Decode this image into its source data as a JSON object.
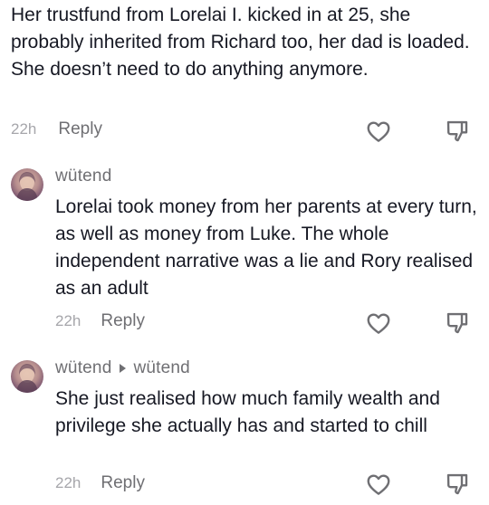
{
  "comments": [
    {
      "username": "",
      "text": "Her trustfund from Lorelai I. kicked in at 25, she probably inherited from Richard too, her dad is loaded. She doesn’t need to do anything anymore.",
      "time": "22h",
      "reply_label": "Reply"
    },
    {
      "username": "wütend",
      "text": "Lorelai took money from her parents at every turn, as well as money from Luke. The whole independent narrative was a lie and Rory realised as an adult",
      "time": "22h",
      "reply_label": "Reply"
    },
    {
      "username": "wütend",
      "reply_to": "wütend",
      "text": "She just realised how much family wealth and privilege she actually has and started to chill",
      "time": "22h",
      "reply_label": "Reply"
    }
  ],
  "icons": {
    "like": "heart-icon",
    "dislike": "thumbs-down-icon",
    "reply_arrow": "play-triangle-icon",
    "avatar": "avatar"
  },
  "colors": {
    "text": "#161823",
    "secondary": "#6f6f73",
    "muted": "#a6a6ab"
  }
}
